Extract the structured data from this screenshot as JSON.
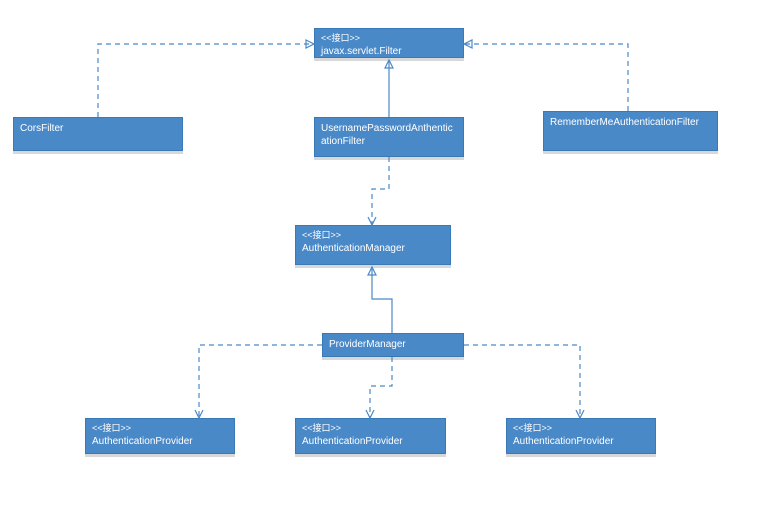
{
  "boxes": {
    "filter": {
      "stereotype": "<<接口>>",
      "name": "javax.servlet.Filter"
    },
    "corsFilter": {
      "name": "CorsFilter"
    },
    "usernameFilter": {
      "name": "UsernamePasswordAnthenticationFilter"
    },
    "rememberFilter": {
      "name": "RememberMeAuthenticationFilter"
    },
    "authManager": {
      "stereotype": "<<接口>>",
      "name": "AuthenticationManager"
    },
    "providerManager": {
      "name": "ProviderManager"
    },
    "authProvider1": {
      "stereotype": "<<接口>>",
      "name": "AuthenticationProvider"
    },
    "authProvider2": {
      "stereotype": "<<接口>>",
      "name": "AuthenticationProvider"
    },
    "authProvider3": {
      "stereotype": "<<接口>>",
      "name": "AuthenticationProvider"
    }
  }
}
